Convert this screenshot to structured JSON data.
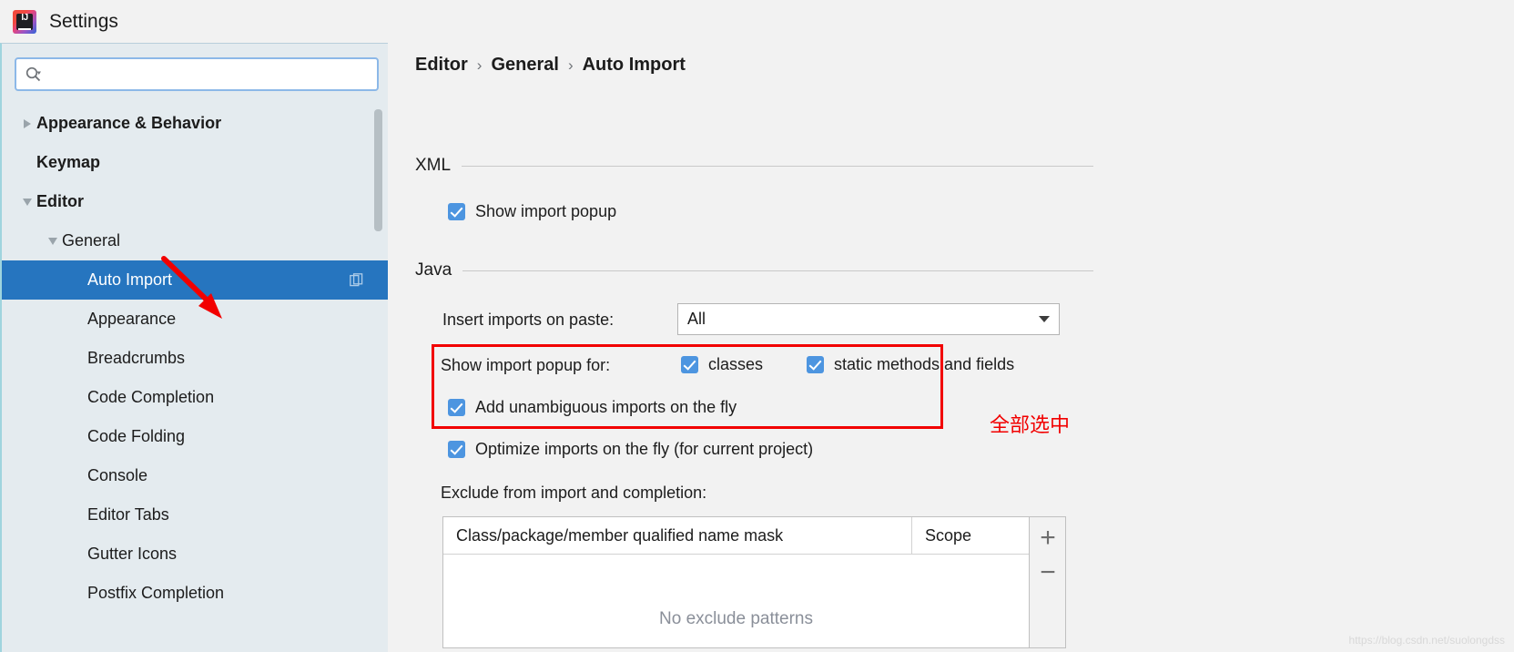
{
  "window": {
    "title": "Settings",
    "logo_icon": "intellij-idea-logo",
    "logo_text": "IJ"
  },
  "sidebar": {
    "search": {
      "value": "",
      "placeholder": "",
      "icon": "search-icon"
    },
    "items": [
      {
        "label": "Appearance & Behavior",
        "level": 0,
        "bold": true,
        "twisty": "collapsed",
        "selected": false
      },
      {
        "label": "Keymap",
        "level": 0,
        "bold": true,
        "twisty": "none",
        "selected": false
      },
      {
        "label": "Editor",
        "level": 0,
        "bold": true,
        "twisty": "expanded",
        "selected": false
      },
      {
        "label": "General",
        "level": 1,
        "bold": false,
        "twisty": "expanded",
        "selected": false
      },
      {
        "label": "Auto Import",
        "level": 2,
        "bold": false,
        "twisty": "none",
        "selected": true
      },
      {
        "label": "Appearance",
        "level": 2,
        "bold": false,
        "twisty": "none",
        "selected": false
      },
      {
        "label": "Breadcrumbs",
        "level": 2,
        "bold": false,
        "twisty": "none",
        "selected": false
      },
      {
        "label": "Code Completion",
        "level": 2,
        "bold": false,
        "twisty": "none",
        "selected": false
      },
      {
        "label": "Code Folding",
        "level": 2,
        "bold": false,
        "twisty": "none",
        "selected": false
      },
      {
        "label": "Console",
        "level": 2,
        "bold": false,
        "twisty": "none",
        "selected": false
      },
      {
        "label": "Editor Tabs",
        "level": 2,
        "bold": false,
        "twisty": "none",
        "selected": false
      },
      {
        "label": "Gutter Icons",
        "level": 2,
        "bold": false,
        "twisty": "none",
        "selected": false
      },
      {
        "label": "Postfix Completion",
        "level": 2,
        "bold": false,
        "twisty": "none",
        "selected": false
      }
    ],
    "selected_row_icon": "copy-settings-icon"
  },
  "main": {
    "breadcrumb": {
      "parts": [
        "Editor",
        "General",
        "Auto Import"
      ],
      "separator": "›"
    },
    "xml_section": {
      "title": "XML",
      "show_import_popup": {
        "label": "Show import popup",
        "checked": true
      }
    },
    "java_section": {
      "title": "Java",
      "insert_imports": {
        "label": "Insert imports on paste:",
        "value": "All",
        "arrow_icon": "chevron-down-icon"
      },
      "show_popup_for": {
        "label": "Show import popup for:",
        "classes": {
          "label": "classes",
          "checked": true
        },
        "static_members": {
          "label": "static methods and fields",
          "checked": true
        }
      },
      "add_unambiguous": {
        "label": "Add unambiguous imports on the fly",
        "checked": true
      },
      "optimize_on_fly": {
        "label": "Optimize imports on the fly (for current project)",
        "checked": true
      },
      "exclude": {
        "label": "Exclude from import and completion:",
        "columns": [
          "Class/package/member qualified name mask",
          "Scope"
        ],
        "rows": [],
        "empty_text": "No exclude patterns",
        "add_button": "+",
        "remove_button": "−"
      }
    },
    "annotations": {
      "chinese_note": "全部选中",
      "note_color": "#f20000",
      "arrow_icon": "red-arrow-annotation",
      "box_color": "#f20000"
    },
    "watermark": "https://blog.csdn.net/suolongdss"
  }
}
